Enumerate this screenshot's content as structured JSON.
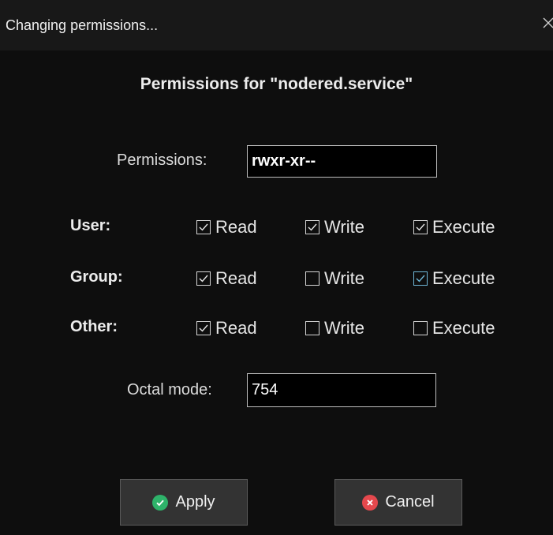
{
  "window": {
    "title": "Changing permissions..."
  },
  "dialog": {
    "heading": "Permissions for \"nodered.service\"",
    "permissions_label": "Permissions:",
    "permissions_value": "rwxr-xr--",
    "octal_label": "Octal mode:",
    "octal_value": "754",
    "column_labels": {
      "read": "Read",
      "write": "Write",
      "execute": "Execute"
    },
    "rows": [
      {
        "label": "User:",
        "read": true,
        "write": true,
        "execute": true
      },
      {
        "label": "Group:",
        "read": true,
        "write": false,
        "execute": true
      },
      {
        "label": "Other:",
        "read": true,
        "write": false,
        "execute": false
      }
    ],
    "buttons": {
      "apply": "Apply",
      "cancel": "Cancel"
    }
  },
  "colors": {
    "checkbox_focus": "#6fb7d6",
    "apply_icon": "#2eb36a",
    "cancel_icon": "#e5484d"
  },
  "icons": {
    "close": "close-icon",
    "apply": "checkmark-circle-icon",
    "cancel": "x-circle-icon"
  }
}
